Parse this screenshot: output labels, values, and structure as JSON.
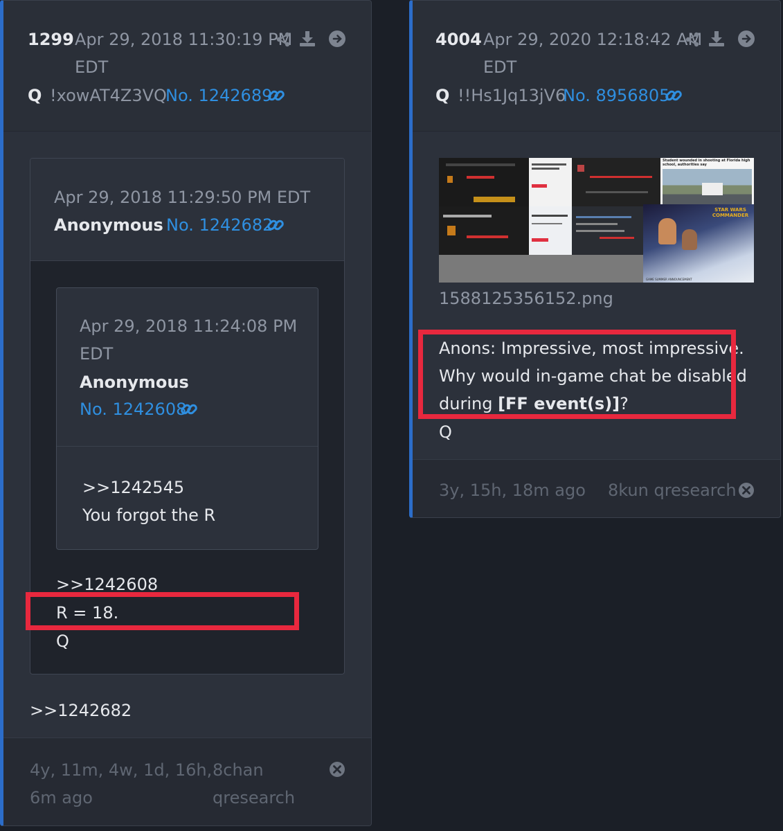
{
  "left": {
    "post_number": "1299",
    "timestamp": "Apr 29, 2018 11:30:19 PM",
    "timezone": "EDT",
    "author": "Q",
    "tripcode": "!xowAT4Z3VQ",
    "post_id": "No. 1242689",
    "quoted": {
      "timestamp": "Apr 29, 2018 11:29:50 PM EDT",
      "author": "Anonymous",
      "post_id": "No. 1242682",
      "nested": {
        "timestamp": "Apr 29, 2018 11:24:08 PM",
        "timezone": "EDT",
        "author": "Anonymous",
        "post_id": "No. 1242608",
        "line1": ">>1242545",
        "line2": "You forgot the R"
      },
      "line1": ">>1242608",
      "line2": "R = 18.",
      "line3": "Q"
    },
    "body": ">>1242682",
    "age_line1": "4y, 11m, 4w, 1d, 16h,",
    "age_line2": "6m ago",
    "source_line1": "8chan",
    "source_line2": "qresearch"
  },
  "right": {
    "post_number": "4004",
    "timestamp": "Apr 29, 2020 12:18:42 AM",
    "timezone": "EDT",
    "author": "Q",
    "tripcode": "!!Hs1Jq13jV6",
    "post_id": "No. 8956805",
    "image_filename": "1588125356152.png",
    "image_caption_text": "Student wounded in shooting at Florida high school, authorities say",
    "image_banner_text": "STAR WARS COMMANDER",
    "image_footer_text": "GAME SUMMER ANNOUNCEMENT",
    "body_line1": "Anons: Impressive, most impressive.",
    "body_line2": "Why would in-game chat be disabled",
    "body_line3_prefix": "during ",
    "body_line3_bold": "[FF event(s)]",
    "body_line3_suffix": "?",
    "body_line4": "Q",
    "age": "3y, 15h, 18m ago",
    "source": "8kun qresearch"
  },
  "colors": {
    "accent": "#2c6dc9",
    "link": "#2f8fe0",
    "highlight": "#e8283e",
    "background": "#1b1f27",
    "card": "#2c313b"
  },
  "icons": [
    "share-icon",
    "download-icon",
    "arrow-right-circle-icon",
    "link-icon",
    "close-circle-icon"
  ]
}
